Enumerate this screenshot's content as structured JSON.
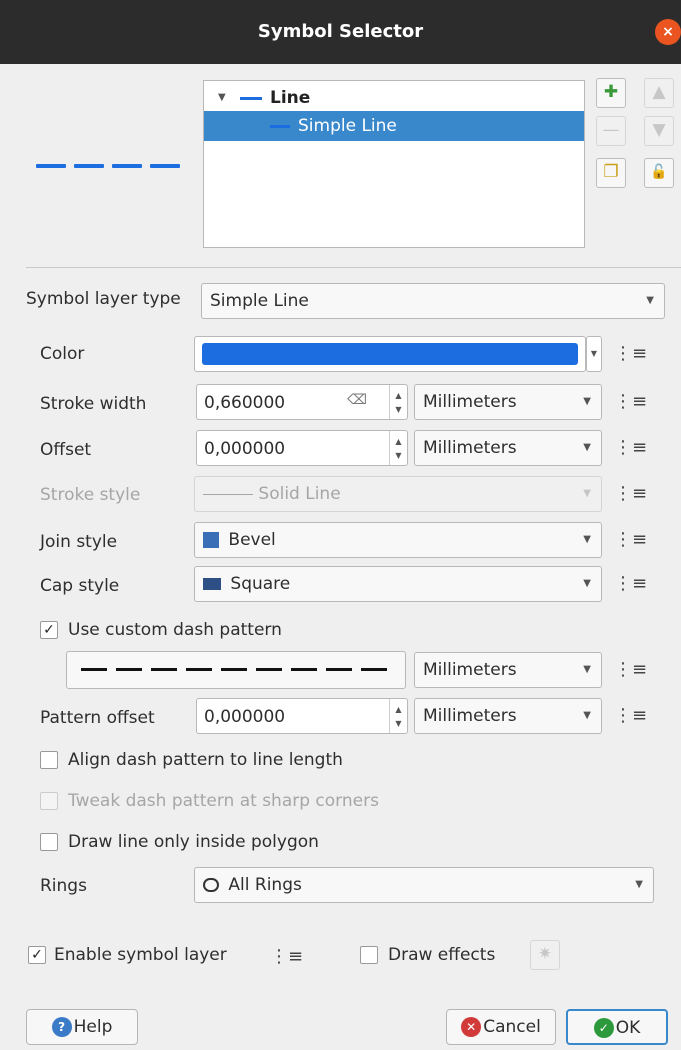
{
  "window": {
    "title": "Symbol Selector",
    "close_glyph": "×"
  },
  "tree": {
    "items": [
      {
        "label": "Line",
        "selected": false
      },
      {
        "label": "Simple Line",
        "selected": true
      }
    ]
  },
  "tools": {
    "add": "✚",
    "remove": "—",
    "up": "▲",
    "down": "▼",
    "duplicate": "❐",
    "lock": "🔓"
  },
  "symbol_layer_type": {
    "label": "Symbol layer type",
    "value": "Simple Line"
  },
  "color": {
    "label": "Color",
    "value": "#1c6ee0"
  },
  "stroke_width": {
    "label": "Stroke width",
    "value": "0,660000",
    "unit": "Millimeters"
  },
  "offset": {
    "label": "Offset",
    "value": "0,000000",
    "unit": "Millimeters"
  },
  "stroke_style": {
    "label": "Stroke style",
    "value": "Solid Line"
  },
  "join_style": {
    "label": "Join style",
    "value": "Bevel"
  },
  "cap_style": {
    "label": "Cap style",
    "value": "Square"
  },
  "custom_dash": {
    "label": "Use custom dash pattern",
    "checked": true,
    "unit": "Millimeters"
  },
  "pattern_offset": {
    "label": "Pattern offset",
    "value": "0,000000",
    "unit": "Millimeters"
  },
  "align_dash": {
    "label": "Align dash pattern to line length",
    "checked": false
  },
  "tweak_dash": {
    "label": "Tweak dash pattern at sharp corners",
    "checked": false
  },
  "inside_polygon": {
    "label": "Draw line only inside polygon",
    "checked": false
  },
  "rings": {
    "label": "Rings",
    "value": "All Rings"
  },
  "enable_layer": {
    "label": "Enable symbol layer",
    "checked": true
  },
  "draw_effects": {
    "label": "Draw effects",
    "checked": false
  },
  "buttons": {
    "help": "Help",
    "cancel": "Cancel",
    "ok": "OK"
  },
  "check_glyph": "✓",
  "colors": {
    "accent": "#1c6ee0",
    "selection": "#3a88cc",
    "close": "#e95420"
  }
}
